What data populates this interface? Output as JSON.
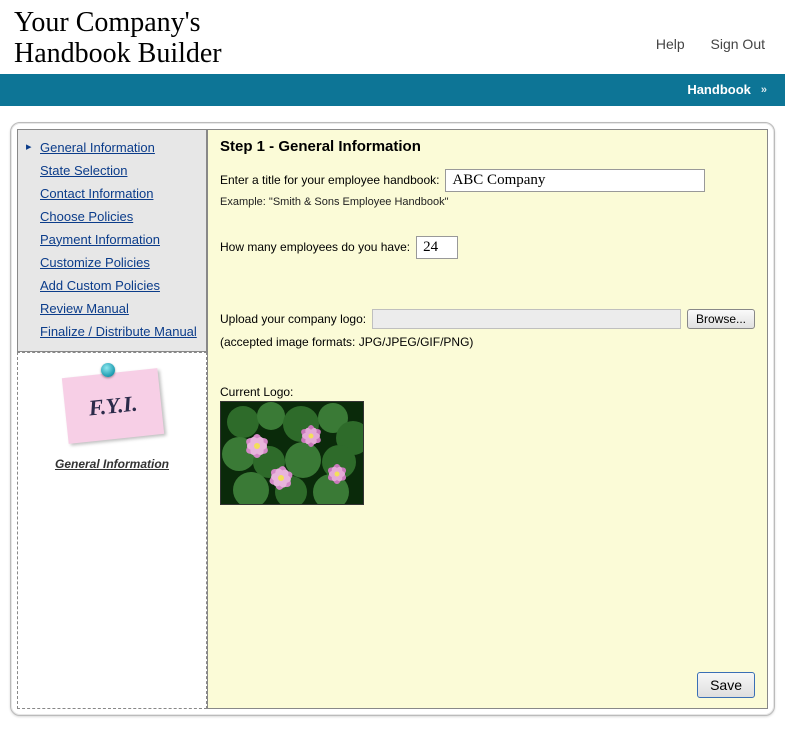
{
  "header": {
    "title_line1": "Your Company's",
    "title_line2": "Handbook Builder",
    "links": {
      "help": "Help",
      "signout": "Sign Out"
    }
  },
  "navbar": {
    "item": "Handbook",
    "chevron": "»"
  },
  "sidebar": {
    "items": [
      {
        "label": "General Information",
        "active": true
      },
      {
        "label": "State Selection"
      },
      {
        "label": "Contact Information"
      },
      {
        "label": "Choose Policies"
      },
      {
        "label": "Payment Information"
      },
      {
        "label": "Customize Policies"
      },
      {
        "label": "Add Custom Policies"
      },
      {
        "label": "Review Manual"
      },
      {
        "label": "Finalize / Distribute Manual"
      }
    ],
    "fyi": {
      "note_text": "F.Y.I.",
      "caption": "General Information"
    }
  },
  "main": {
    "step_title": "Step 1 - General Information",
    "title_label": "Enter a title for your employee handbook:",
    "title_value": "ABC Company",
    "title_example": "Example: \"Smith & Sons Employee Handbook\"",
    "employees_label": "How many employees do you have:",
    "employees_value": "24",
    "upload_label": "Upload your company logo:",
    "upload_path": "",
    "browse_label": "Browse...",
    "formats_label": "(accepted image formats: JPG/JPEG/GIF/PNG)",
    "current_logo_label": "Current Logo:",
    "save_label": "Save"
  }
}
